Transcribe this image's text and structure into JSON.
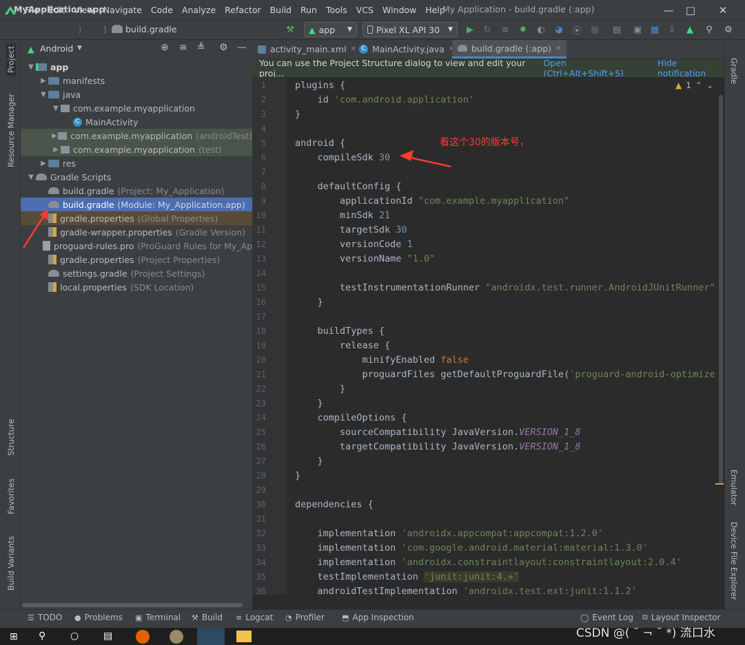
{
  "menu": [
    "File",
    "Edit",
    "View",
    "Navigate",
    "Code",
    "Analyze",
    "Refactor",
    "Build",
    "Run",
    "Tools",
    "VCS",
    "Window",
    "Help"
  ],
  "window_title": "My Application - build.gradle (:app)",
  "navbar": {
    "crumbs": [
      "MyApplication",
      "app",
      "build.gradle"
    ],
    "run_config": "app",
    "device": "Pixel XL API 30"
  },
  "project_panel": {
    "view": "Android",
    "tree": [
      {
        "label": "app",
        "hint": "",
        "indent": 0,
        "arrow": "▼",
        "icon": "module-folder-icon",
        "bold": true,
        "state": ""
      },
      {
        "label": "manifests",
        "hint": "",
        "indent": 1,
        "arrow": "▶",
        "icon": "folder-icon",
        "state": ""
      },
      {
        "label": "java",
        "hint": "",
        "indent": 1,
        "arrow": "▼",
        "icon": "folder-icon",
        "state": ""
      },
      {
        "label": "com.example.myapplication",
        "hint": "",
        "indent": 2,
        "arrow": "▼",
        "icon": "package-icon",
        "state": ""
      },
      {
        "label": "MainActivity",
        "hint": "",
        "indent": 3,
        "arrow": "",
        "icon": "class-icon",
        "state": ""
      },
      {
        "label": "com.example.myapplication",
        "hint": "(androidTest)",
        "indent": 2,
        "arrow": "▶",
        "icon": "package-icon",
        "state": "green"
      },
      {
        "label": "com.example.myapplication",
        "hint": "(test)",
        "indent": 2,
        "arrow": "▶",
        "icon": "package-icon",
        "state": "green"
      },
      {
        "label": "res",
        "hint": "",
        "indent": 1,
        "arrow": "▶",
        "icon": "res-folder-icon",
        "state": ""
      },
      {
        "label": "Gradle Scripts",
        "hint": "",
        "indent": 0,
        "arrow": "▼",
        "icon": "gradle-icon",
        "state": ""
      },
      {
        "label": "build.gradle",
        "hint": "(Project: My_Application)",
        "indent": 1,
        "arrow": "",
        "icon": "gradle-icon",
        "state": ""
      },
      {
        "label": "build.gradle",
        "hint": "(Module: My_Application.app)",
        "indent": 1,
        "arrow": "",
        "icon": "gradle-icon",
        "state": "selected"
      },
      {
        "label": "gradle.properties",
        "hint": "(Global Properties)",
        "indent": 1,
        "arrow": "",
        "icon": "properties-icon",
        "state": "brown"
      },
      {
        "label": "gradle-wrapper.properties",
        "hint": "(Gradle Version)",
        "indent": 1,
        "arrow": "",
        "icon": "properties-icon",
        "state": ""
      },
      {
        "label": "proguard-rules.pro",
        "hint": "(ProGuard Rules for My_Ap",
        "indent": 1,
        "arrow": "",
        "icon": "text-file-icon",
        "state": ""
      },
      {
        "label": "gradle.properties",
        "hint": "(Project Properties)",
        "indent": 1,
        "arrow": "",
        "icon": "properties-icon",
        "state": ""
      },
      {
        "label": "settings.gradle",
        "hint": "(Project Settings)",
        "indent": 1,
        "arrow": "",
        "icon": "gradle-icon",
        "state": ""
      },
      {
        "label": "local.properties",
        "hint": "(SDK Location)",
        "indent": 1,
        "arrow": "",
        "icon": "properties-icon",
        "state": ""
      }
    ]
  },
  "left_stripe": [
    "Project",
    "Resource Manager",
    "Structure",
    "Favorites",
    "Build Variants"
  ],
  "right_stripe": [
    "Gradle",
    "Emulator",
    "Device File Explorer"
  ],
  "editor": {
    "tabs": [
      "activity_main.xml",
      "MainActivity.java",
      "build.gradle (:app)"
    ],
    "active_tab": 2,
    "notification": {
      "text": "You can use the Project Structure dialog to view and edit your proj...",
      "open_link": "Open (Ctrl+Alt+Shift+S)",
      "hide_link": "Hide notification"
    },
    "inspection_count": "1",
    "annotation": "看这个30的版本号，",
    "lines": [
      {
        "n": "1",
        "t": [
          [
            "kw2",
            "plugins"
          ],
          [
            "p",
            " {"
          ]
        ]
      },
      {
        "n": "2",
        "t": [
          [
            "p",
            "    id "
          ],
          [
            "s",
            "'com.android.application'"
          ]
        ]
      },
      {
        "n": "3",
        "t": [
          [
            "p",
            "}"
          ]
        ]
      },
      {
        "n": "4",
        "t": []
      },
      {
        "n": "5",
        "t": [
          [
            "p",
            "android {"
          ]
        ]
      },
      {
        "n": "6",
        "t": [
          [
            "p",
            "    compileSdk "
          ],
          [
            "n",
            "30"
          ]
        ]
      },
      {
        "n": "7",
        "t": []
      },
      {
        "n": "8",
        "t": [
          [
            "p",
            "    "
          ],
          [
            "kw2",
            "defaultConfig"
          ],
          [
            "p",
            " {"
          ]
        ]
      },
      {
        "n": "9",
        "t": [
          [
            "p",
            "        applicationId "
          ],
          [
            "s",
            "\"com.example.myapplication\""
          ]
        ]
      },
      {
        "n": "10",
        "t": [
          [
            "p",
            "        minSdk "
          ],
          [
            "n",
            "21"
          ]
        ]
      },
      {
        "n": "11",
        "t": [
          [
            "p",
            "        targetSdk "
          ],
          [
            "n",
            "30"
          ]
        ]
      },
      {
        "n": "12",
        "t": [
          [
            "p",
            "        versionCode "
          ],
          [
            "n",
            "1"
          ]
        ]
      },
      {
        "n": "13",
        "t": [
          [
            "p",
            "        versionName "
          ],
          [
            "s",
            "\"1.0\""
          ]
        ]
      },
      {
        "n": "14",
        "t": []
      },
      {
        "n": "15",
        "t": [
          [
            "p",
            "        testInstrumentationRunner "
          ],
          [
            "s",
            "\"androidx.test.runner.AndroidJUnitRunner\""
          ]
        ]
      },
      {
        "n": "16",
        "t": [
          [
            "p",
            "    }"
          ]
        ]
      },
      {
        "n": "17",
        "t": []
      },
      {
        "n": "18",
        "t": [
          [
            "p",
            "    "
          ],
          [
            "kw2",
            "buildTypes"
          ],
          [
            "p",
            " {"
          ]
        ]
      },
      {
        "n": "19",
        "t": [
          [
            "p",
            "        release {"
          ]
        ]
      },
      {
        "n": "20",
        "t": [
          [
            "p",
            "            minifyEnabled "
          ],
          [
            "k",
            "false"
          ]
        ]
      },
      {
        "n": "21",
        "t": [
          [
            "p",
            "            proguardFiles getDefaultProguardFile("
          ],
          [
            "s",
            "'proguard-android-optimize.tx"
          ]
        ]
      },
      {
        "n": "22",
        "t": [
          [
            "p",
            "        }"
          ]
        ]
      },
      {
        "n": "23",
        "t": [
          [
            "p",
            "    }"
          ]
        ]
      },
      {
        "n": "24",
        "t": [
          [
            "p",
            "    compileOptions {"
          ]
        ]
      },
      {
        "n": "25",
        "t": [
          [
            "p",
            "        sourceCompatibility JavaVersion."
          ],
          [
            "c",
            "VERSION_1_8"
          ]
        ]
      },
      {
        "n": "26",
        "t": [
          [
            "p",
            "        targetCompatibility JavaVersion."
          ],
          [
            "c",
            "VERSION_1_8"
          ]
        ]
      },
      {
        "n": "27",
        "t": [
          [
            "p",
            "    }"
          ]
        ]
      },
      {
        "n": "28",
        "t": [
          [
            "p",
            "}"
          ]
        ]
      },
      {
        "n": "29",
        "t": []
      },
      {
        "n": "30",
        "t": [
          [
            "p",
            "dependencies {"
          ]
        ]
      },
      {
        "n": "31",
        "t": []
      },
      {
        "n": "32",
        "t": [
          [
            "p",
            "    implementation "
          ],
          [
            "s",
            "'androidx.appcompat:appcompat:1.2.0'"
          ]
        ]
      },
      {
        "n": "33",
        "t": [
          [
            "p",
            "    implementation "
          ],
          [
            "s",
            "'com.google.android.material:material:1.3.0'"
          ]
        ]
      },
      {
        "n": "34",
        "t": [
          [
            "p",
            "    implementation "
          ],
          [
            "s",
            "'androidx.constraintlayout:constraintlayout:2.0.4'"
          ]
        ]
      },
      {
        "n": "35",
        "t": [
          [
            "p",
            "    testImplementation "
          ],
          [
            "sh",
            "'junit:junit:4.+'"
          ]
        ]
      },
      {
        "n": "36",
        "t": [
          [
            "p",
            "    androidTestImplementation "
          ],
          [
            "s",
            "'androidx.test.ext:junit:1.1.2'"
          ]
        ]
      }
    ]
  },
  "bottom_tabs": [
    {
      "label": "TODO",
      "icon": "list-icon"
    },
    {
      "label": "Problems",
      "icon": "problems-icon"
    },
    {
      "label": "Terminal",
      "icon": "terminal-icon"
    },
    {
      "label": "Build",
      "icon": "hammer-icon"
    },
    {
      "label": "Logcat",
      "icon": "logcat-icon"
    },
    {
      "label": "Profiler",
      "icon": "profiler-icon"
    },
    {
      "label": "App Inspection",
      "icon": "app-inspection-icon"
    },
    {
      "label": "Event Log",
      "icon": "event-log-icon"
    },
    {
      "label": "Layout Inspector",
      "icon": "layout-inspector-icon"
    }
  ],
  "watermark": "CSDN @( ¯ ¬ ¯ *) 流口水",
  "colors": {
    "accent": "#4a88c7",
    "selection": "#4b6eaf",
    "annotation": "#ff3b30",
    "link": "#589df6"
  }
}
